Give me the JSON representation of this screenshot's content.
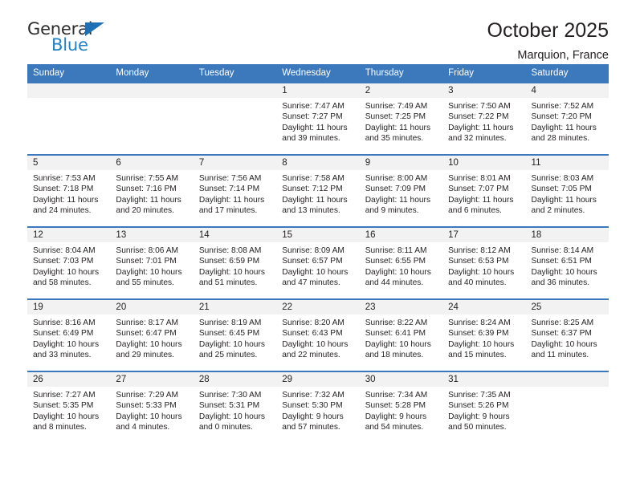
{
  "brand": {
    "name_top": "General",
    "name_bottom": "Blue",
    "accent_color": "#2281c6",
    "triangle_color": "#1f6fb5"
  },
  "header": {
    "title": "October 2025",
    "location": "Marquion, France"
  },
  "calendar": {
    "header_bg": "#3b78bc",
    "daynum_bg": "#f2f2f2",
    "weekdays": [
      "Sunday",
      "Monday",
      "Tuesday",
      "Wednesday",
      "Thursday",
      "Friday",
      "Saturday"
    ],
    "weeks": [
      [
        {
          "day": "",
          "sunrise": "",
          "sunset": "",
          "daylight": ""
        },
        {
          "day": "",
          "sunrise": "",
          "sunset": "",
          "daylight": ""
        },
        {
          "day": "",
          "sunrise": "",
          "sunset": "",
          "daylight": ""
        },
        {
          "day": "1",
          "sunrise": "Sunrise: 7:47 AM",
          "sunset": "Sunset: 7:27 PM",
          "daylight": "Daylight: 11 hours and 39 minutes."
        },
        {
          "day": "2",
          "sunrise": "Sunrise: 7:49 AM",
          "sunset": "Sunset: 7:25 PM",
          "daylight": "Daylight: 11 hours and 35 minutes."
        },
        {
          "day": "3",
          "sunrise": "Sunrise: 7:50 AM",
          "sunset": "Sunset: 7:22 PM",
          "daylight": "Daylight: 11 hours and 32 minutes."
        },
        {
          "day": "4",
          "sunrise": "Sunrise: 7:52 AM",
          "sunset": "Sunset: 7:20 PM",
          "daylight": "Daylight: 11 hours and 28 minutes."
        }
      ],
      [
        {
          "day": "5",
          "sunrise": "Sunrise: 7:53 AM",
          "sunset": "Sunset: 7:18 PM",
          "daylight": "Daylight: 11 hours and 24 minutes."
        },
        {
          "day": "6",
          "sunrise": "Sunrise: 7:55 AM",
          "sunset": "Sunset: 7:16 PM",
          "daylight": "Daylight: 11 hours and 20 minutes."
        },
        {
          "day": "7",
          "sunrise": "Sunrise: 7:56 AM",
          "sunset": "Sunset: 7:14 PM",
          "daylight": "Daylight: 11 hours and 17 minutes."
        },
        {
          "day": "8",
          "sunrise": "Sunrise: 7:58 AM",
          "sunset": "Sunset: 7:12 PM",
          "daylight": "Daylight: 11 hours and 13 minutes."
        },
        {
          "day": "9",
          "sunrise": "Sunrise: 8:00 AM",
          "sunset": "Sunset: 7:09 PM",
          "daylight": "Daylight: 11 hours and 9 minutes."
        },
        {
          "day": "10",
          "sunrise": "Sunrise: 8:01 AM",
          "sunset": "Sunset: 7:07 PM",
          "daylight": "Daylight: 11 hours and 6 minutes."
        },
        {
          "day": "11",
          "sunrise": "Sunrise: 8:03 AM",
          "sunset": "Sunset: 7:05 PM",
          "daylight": "Daylight: 11 hours and 2 minutes."
        }
      ],
      [
        {
          "day": "12",
          "sunrise": "Sunrise: 8:04 AM",
          "sunset": "Sunset: 7:03 PM",
          "daylight": "Daylight: 10 hours and 58 minutes."
        },
        {
          "day": "13",
          "sunrise": "Sunrise: 8:06 AM",
          "sunset": "Sunset: 7:01 PM",
          "daylight": "Daylight: 10 hours and 55 minutes."
        },
        {
          "day": "14",
          "sunrise": "Sunrise: 8:08 AM",
          "sunset": "Sunset: 6:59 PM",
          "daylight": "Daylight: 10 hours and 51 minutes."
        },
        {
          "day": "15",
          "sunrise": "Sunrise: 8:09 AM",
          "sunset": "Sunset: 6:57 PM",
          "daylight": "Daylight: 10 hours and 47 minutes."
        },
        {
          "day": "16",
          "sunrise": "Sunrise: 8:11 AM",
          "sunset": "Sunset: 6:55 PM",
          "daylight": "Daylight: 10 hours and 44 minutes."
        },
        {
          "day": "17",
          "sunrise": "Sunrise: 8:12 AM",
          "sunset": "Sunset: 6:53 PM",
          "daylight": "Daylight: 10 hours and 40 minutes."
        },
        {
          "day": "18",
          "sunrise": "Sunrise: 8:14 AM",
          "sunset": "Sunset: 6:51 PM",
          "daylight": "Daylight: 10 hours and 36 minutes."
        }
      ],
      [
        {
          "day": "19",
          "sunrise": "Sunrise: 8:16 AM",
          "sunset": "Sunset: 6:49 PM",
          "daylight": "Daylight: 10 hours and 33 minutes."
        },
        {
          "day": "20",
          "sunrise": "Sunrise: 8:17 AM",
          "sunset": "Sunset: 6:47 PM",
          "daylight": "Daylight: 10 hours and 29 minutes."
        },
        {
          "day": "21",
          "sunrise": "Sunrise: 8:19 AM",
          "sunset": "Sunset: 6:45 PM",
          "daylight": "Daylight: 10 hours and 25 minutes."
        },
        {
          "day": "22",
          "sunrise": "Sunrise: 8:20 AM",
          "sunset": "Sunset: 6:43 PM",
          "daylight": "Daylight: 10 hours and 22 minutes."
        },
        {
          "day": "23",
          "sunrise": "Sunrise: 8:22 AM",
          "sunset": "Sunset: 6:41 PM",
          "daylight": "Daylight: 10 hours and 18 minutes."
        },
        {
          "day": "24",
          "sunrise": "Sunrise: 8:24 AM",
          "sunset": "Sunset: 6:39 PM",
          "daylight": "Daylight: 10 hours and 15 minutes."
        },
        {
          "day": "25",
          "sunrise": "Sunrise: 8:25 AM",
          "sunset": "Sunset: 6:37 PM",
          "daylight": "Daylight: 10 hours and 11 minutes."
        }
      ],
      [
        {
          "day": "26",
          "sunrise": "Sunrise: 7:27 AM",
          "sunset": "Sunset: 5:35 PM",
          "daylight": "Daylight: 10 hours and 8 minutes."
        },
        {
          "day": "27",
          "sunrise": "Sunrise: 7:29 AM",
          "sunset": "Sunset: 5:33 PM",
          "daylight": "Daylight: 10 hours and 4 minutes."
        },
        {
          "day": "28",
          "sunrise": "Sunrise: 7:30 AM",
          "sunset": "Sunset: 5:31 PM",
          "daylight": "Daylight: 10 hours and 0 minutes."
        },
        {
          "day": "29",
          "sunrise": "Sunrise: 7:32 AM",
          "sunset": "Sunset: 5:30 PM",
          "daylight": "Daylight: 9 hours and 57 minutes."
        },
        {
          "day": "30",
          "sunrise": "Sunrise: 7:34 AM",
          "sunset": "Sunset: 5:28 PM",
          "daylight": "Daylight: 9 hours and 54 minutes."
        },
        {
          "day": "31",
          "sunrise": "Sunrise: 7:35 AM",
          "sunset": "Sunset: 5:26 PM",
          "daylight": "Daylight: 9 hours and 50 minutes."
        },
        {
          "day": "",
          "sunrise": "",
          "sunset": "",
          "daylight": ""
        }
      ]
    ]
  }
}
